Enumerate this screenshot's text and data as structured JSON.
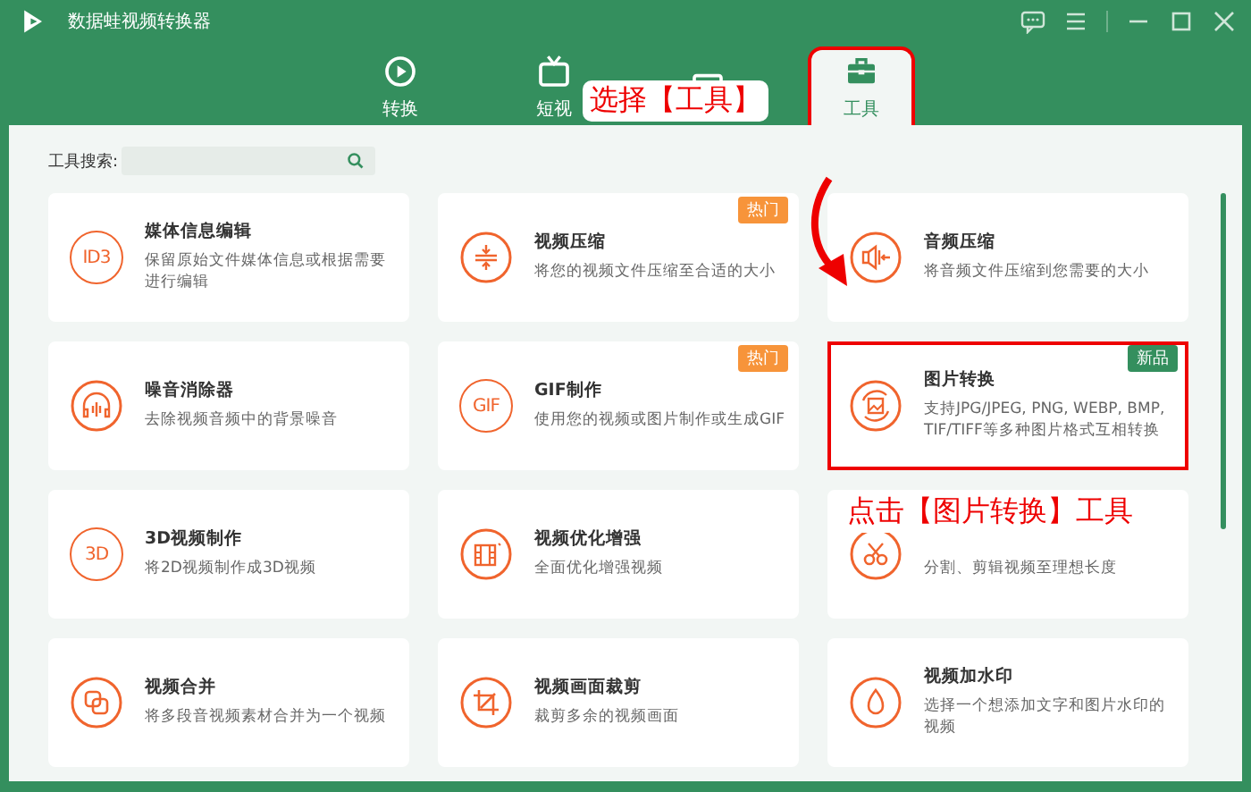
{
  "window": {
    "title": "数据蛙视频转换器"
  },
  "tabs": [
    {
      "label": "转换",
      "selected": false,
      "highlighted": false
    },
    {
      "label": "短视",
      "selected": false,
      "highlighted": false
    },
    {
      "selected": false,
      "highlighted": false
    },
    {
      "label": "工具",
      "selected": true,
      "highlighted": true
    }
  ],
  "search": {
    "label": "工具搜索:"
  },
  "tools": [
    {
      "title": "媒体信息编辑",
      "description": "保留原始文件媒体信息或根据需要进行编辑",
      "icon_text": "ID3",
      "highlighted": false
    },
    {
      "title": "视频压缩",
      "description": "将您的视频文件压缩至合适的大小",
      "badge": {
        "text": "热门",
        "color": "#f7943a"
      },
      "highlighted": false
    },
    {
      "title": "音频压缩",
      "description": "将音频文件压缩到您需要的大小",
      "highlighted": false
    },
    {
      "title": "噪音消除器",
      "description": "去除视频音频中的背景噪音",
      "highlighted": false
    },
    {
      "title": "GIF制作",
      "description": "使用您的视频或图片制作或生成GIF",
      "icon_text": "GIF",
      "badge": {
        "text": "热门",
        "color": "#f7943a"
      },
      "highlighted": false
    },
    {
      "title": "图片转换",
      "description": "支持JPG/JPEG, PNG, WEBP, BMP, TIF/TIFF等多种图片格式互相转换",
      "badge": {
        "text": "新品",
        "color": "#348f5e"
      },
      "highlighted": true
    },
    {
      "title": "3D视频制作",
      "description": "将2D视频制作成3D视频",
      "icon_text": "3D",
      "highlighted": false
    },
    {
      "title": "视频优化增强",
      "description": "全面优化增强视频",
      "highlighted": false
    },
    {
      "description": "分割、剪辑视频至理想长度",
      "highlighted": false
    },
    {
      "title": "视频合并",
      "description": "将多段音视频素材合并为一个视频",
      "highlighted": false
    },
    {
      "title": "视频画面裁剪",
      "description": "裁剪多余的视频画面",
      "highlighted": false
    },
    {
      "title": "视频加水印",
      "description": "选择一个想添加文字和图片水印的视频",
      "highlighted": false
    }
  ],
  "annotations": [
    {
      "kind": "callout",
      "text": "选择【工具】"
    },
    {
      "kind": "callout",
      "text": "点击【图片转换】工具"
    },
    {
      "kind": "arrow"
    }
  ]
}
